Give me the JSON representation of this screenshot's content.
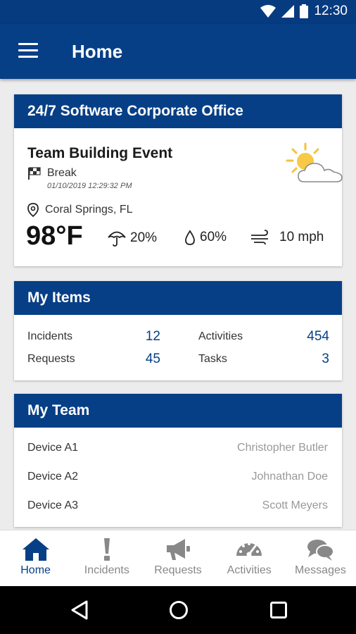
{
  "status_bar": {
    "time": "12:30"
  },
  "app_bar": {
    "title": "Home",
    "menu_icon": "hamburger-menu-icon"
  },
  "office_card": {
    "title": "24/7 Software Corporate Office",
    "event_title": "Team Building Event",
    "status": "Break",
    "timestamp": "01/10/2019 12:29:32 PM",
    "location": "Coral Springs, FL",
    "temperature": "98°F",
    "precipitation": "20%",
    "humidity": "60%",
    "wind": "10 mph",
    "weather_icon": "partly-sunny-icon"
  },
  "items_card": {
    "title": "My Items",
    "items": [
      {
        "label": "Incidents",
        "value": "12"
      },
      {
        "label": "Requests",
        "value": "45"
      },
      {
        "label": "Activities",
        "value": "454"
      },
      {
        "label": "Tasks",
        "value": "3"
      }
    ]
  },
  "team_card": {
    "title": "My Team",
    "members": [
      {
        "device": "Device A1",
        "person": "Christopher Butler"
      },
      {
        "device": "Device A2",
        "person": "Johnathan Doe"
      },
      {
        "device": "Device A3",
        "person": "Scott Meyers"
      }
    ]
  },
  "bottom_nav": {
    "items": [
      {
        "label": "Home",
        "icon": "home-icon",
        "active": true
      },
      {
        "label": "Incidents",
        "icon": "exclamation-icon",
        "active": false
      },
      {
        "label": "Requests",
        "icon": "megaphone-icon",
        "active": false
      },
      {
        "label": "Activities",
        "icon": "speedometer-icon",
        "active": false
      },
      {
        "label": "Messages",
        "icon": "chat-bubbles-icon",
        "active": false
      }
    ]
  },
  "colors": {
    "primary": "#063f86",
    "status_bar": "#063b80",
    "background": "#ececec",
    "inactive_nav": "#888888",
    "secondary_text": "#999999"
  }
}
